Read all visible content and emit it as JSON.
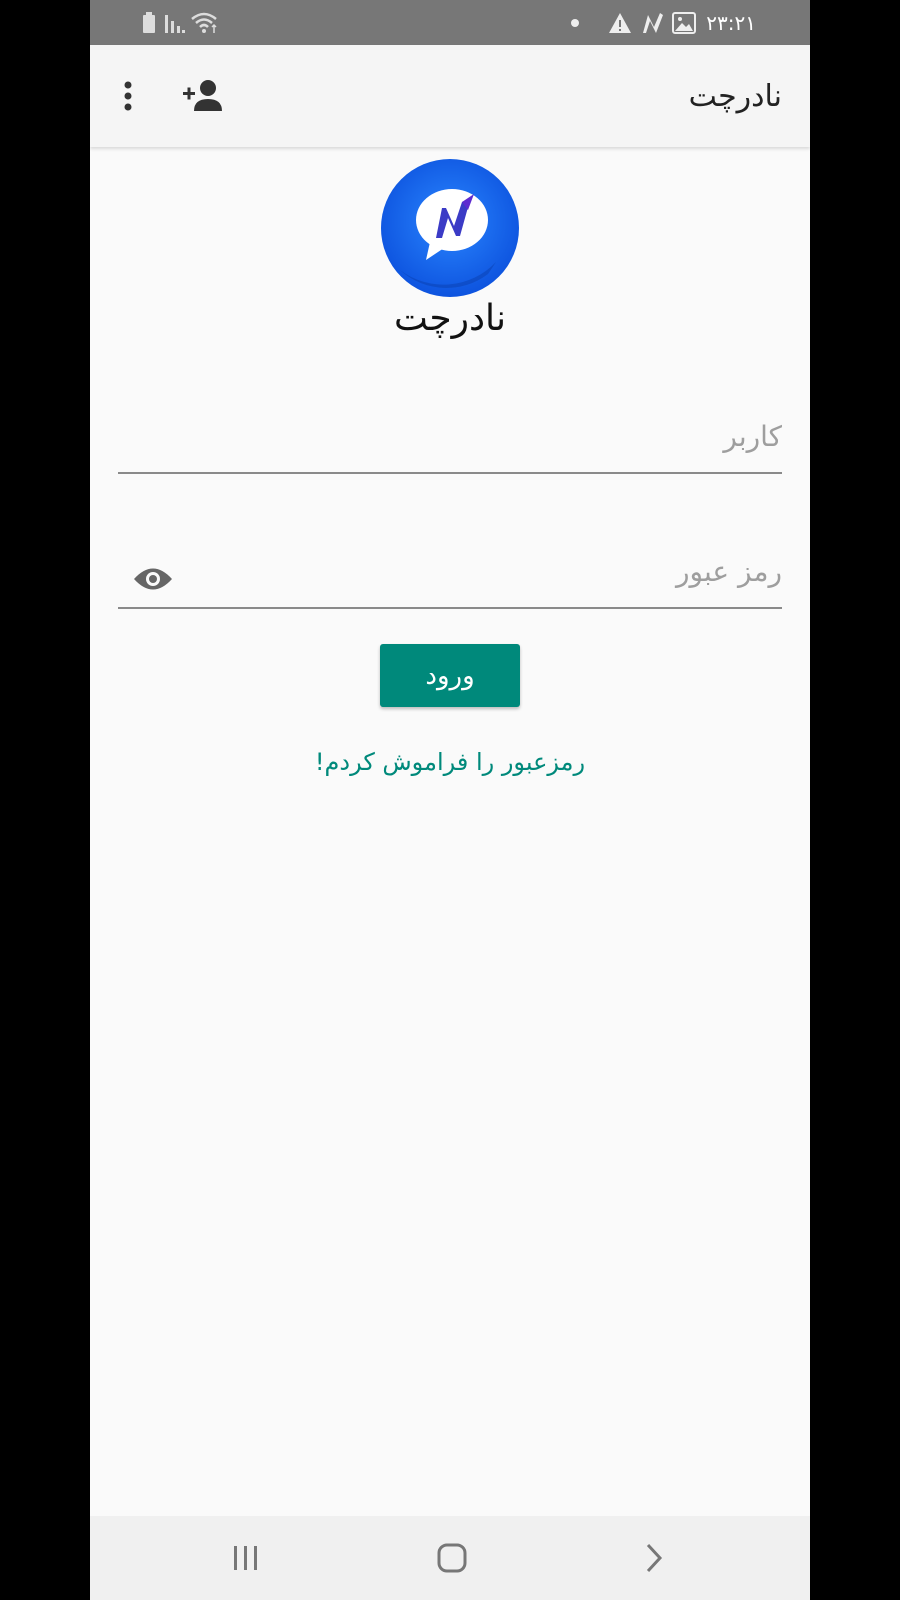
{
  "status_bar": {
    "time": "۲۳:۲۱",
    "icons": [
      "battery-icon",
      "signal-icon",
      "wifi-icon",
      "dot-icon",
      "warning-icon",
      "app-notification-icon",
      "image-icon"
    ]
  },
  "app_bar": {
    "title": "نادرچت",
    "actions": [
      "add-user-icon",
      "more-vert-icon"
    ]
  },
  "logo": {
    "icon": "nader-chat-logo",
    "brand_name": "نادرچت",
    "color": "#1565f0"
  },
  "form": {
    "username": {
      "value": "",
      "placeholder": "کاربر"
    },
    "password": {
      "value": "",
      "placeholder": "رمز عبور",
      "toggle_icon": "eye-icon"
    },
    "login_label": "ورود",
    "forgot_label": "رمزعبور را فراموش کردم!"
  },
  "colors": {
    "accent": "#00897b",
    "status_bar": "#777777",
    "app_bar": "#f5f5f5",
    "logo_blue": "#1565f0"
  },
  "nav_bar": {
    "buttons": [
      "recent-apps-icon",
      "home-icon",
      "back-icon"
    ]
  }
}
